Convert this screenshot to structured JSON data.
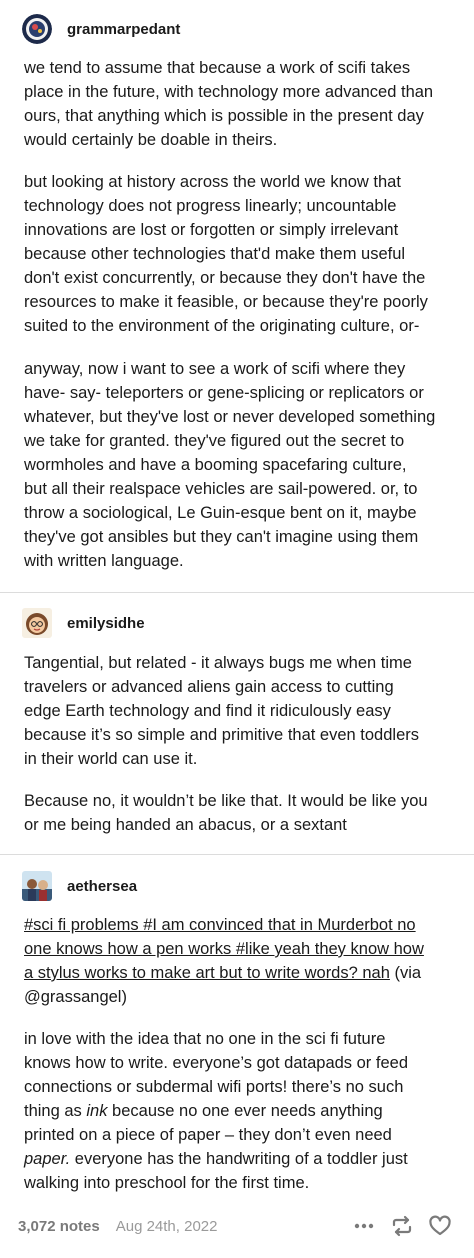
{
  "posts": [
    {
      "username": "grammarpedant",
      "paragraphs": [
        [
          "we tend to assume that because a work of scifi takes",
          "place in the future, with technology more advanced than",
          "ours, that anything which is possible in the present day",
          "would certainly be doable in theirs."
        ],
        [
          "but looking at history across the world we know that",
          "technology does not progress linearly; uncountable",
          "innovations are lost or forgotten or simply irrelevant",
          "because other technologies that'd make them useful",
          "don't exist concurrently, or because they don't have the",
          "resources to make it feasible, or because they're poorly",
          "suited to the environment of the originating culture, or-"
        ],
        [
          "anyway, now i want to see a work of scifi where they",
          "have- say- teleporters or gene-splicing or replicators or",
          "whatever, but they've lost or never developed something",
          "we take for granted. they've figured out the secret to",
          "wormholes and have a booming spacefaring culture,",
          "but all their realspace vehicles are sail-powered. or, to",
          "throw a sociological, Le Guin-esque bent on it, maybe",
          "they've got ansibles but they can't imagine using them",
          "with written language."
        ]
      ]
    },
    {
      "username": "emilysidhe",
      "paragraphs": [
        [
          "Tangential, but related - it always bugs me when time",
          "travelers or advanced aliens gain access to cutting",
          "edge Earth technology and find it ridiculously easy",
          "because it’s so simple and primitive that even toddlers",
          "in their world can use it."
        ],
        [
          "Because no, it wouldn’t be like that. It would be like you",
          "or me being handed an abacus, or a sextant"
        ]
      ]
    },
    {
      "username": "aethersea",
      "tags": {
        "line1": "#sci fi problems #I am convinced that in Murderbot no",
        "line2": "one knows how a pen works #like yeah they know how",
        "line3_tag": "a stylus works to make art but to write words? nah",
        "line3_rest": " (via",
        "line4": "@grassangel)"
      },
      "body": {
        "l1": "in love with the idea that no one in the sci fi future",
        "l2": "knows how to write. everyone’s got datapads or feed",
        "l3": "connections or subdermal wifi ports! there’s no such",
        "l4_a": "thing as ",
        "l4_ink": "ink",
        "l4_b": " because no one ever needs anything",
        "l5": "printed on a piece of paper – they don’t even need",
        "l6_paper": "paper.",
        "l6_b": " everyone has the handwriting of a toddler just",
        "l7": "walking into preschool for the first time."
      }
    }
  ],
  "footer": {
    "notes": "3,072 notes",
    "date": "Aug 24th, 2022",
    "icons": [
      "more-icon",
      "reblog-icon",
      "like-icon"
    ]
  },
  "colors": {
    "text": "#1a1a1a",
    "muted": "#7a7a7a",
    "divider": "#dcdcdc"
  }
}
